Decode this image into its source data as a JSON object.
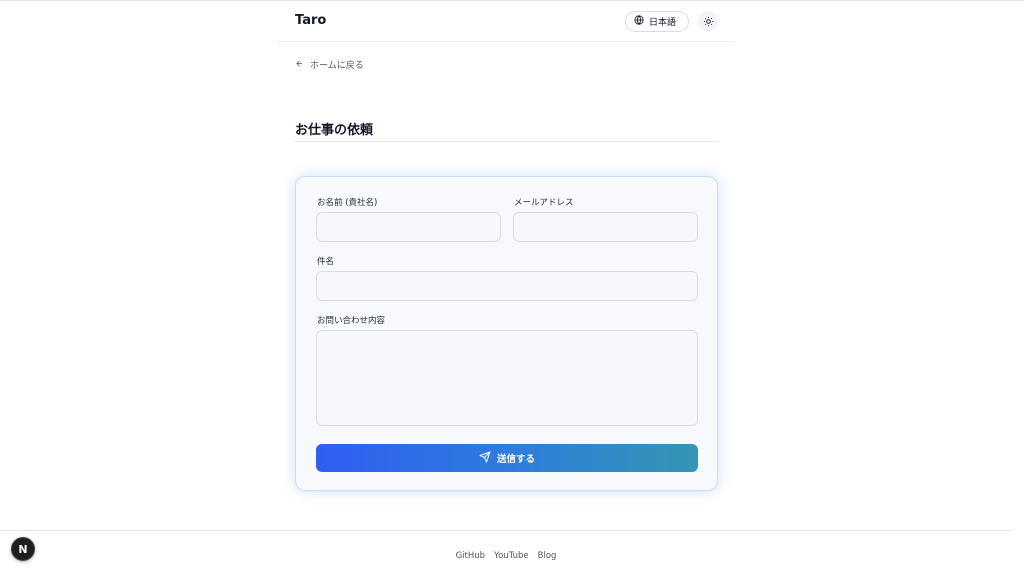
{
  "header": {
    "brand": "Taro",
    "language_label": "日本語",
    "icons": {
      "language": "globe-icon",
      "theme": "sun-icon"
    }
  },
  "nav": {
    "back_label": "ホームに戻る",
    "back_icon": "arrow-left-icon"
  },
  "page": {
    "title": "お仕事の依頼"
  },
  "form": {
    "name_label": "お名前 (貴社名)",
    "email_label": "メールアドレス",
    "subject_label": "件名",
    "message_label": "お問い合わせ内容",
    "submit_label": "送信する",
    "submit_icon": "send-icon",
    "colors": {
      "submit_start": "#2f5ef3",
      "submit_end": "#3596b4",
      "card_border": "#c9dcf7"
    }
  },
  "footer": {
    "links": [
      "GitHub",
      "YouTube",
      "Blog"
    ]
  },
  "dev_badge": {
    "label": "N"
  }
}
